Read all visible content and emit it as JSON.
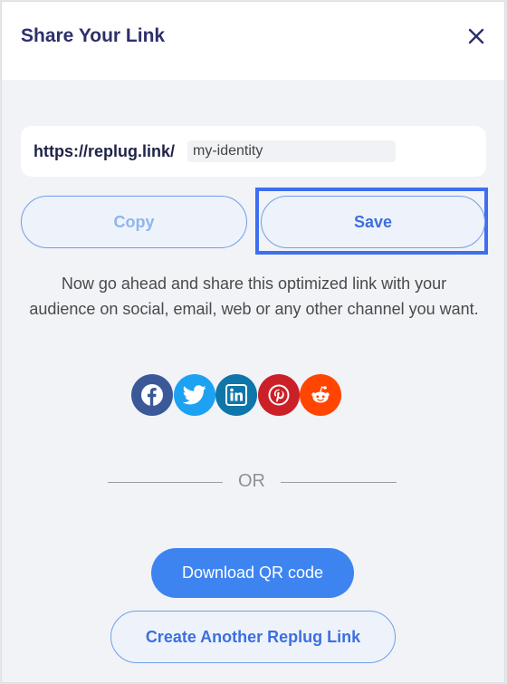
{
  "dialog": {
    "title": "Share Your Link",
    "close_icon": "close-icon"
  },
  "link": {
    "base_url": "https://replug.link/",
    "slug_value": "my-identity"
  },
  "buttons": {
    "copy_label": "Copy",
    "save_label": "Save",
    "download_qr_label": "Download QR code",
    "create_another_label": "Create Another Replug Link"
  },
  "message": "Now go ahead and share this optimized link with your audience on social, email, web or any other channel you want.",
  "socials": [
    {
      "name": "facebook-icon",
      "color": "#3b5998"
    },
    {
      "name": "twitter-icon",
      "color": "#1da1f2"
    },
    {
      "name": "linkedin-icon",
      "color": "#0e76a8"
    },
    {
      "name": "pinterest-icon",
      "color": "#cb2027"
    },
    {
      "name": "reddit-icon",
      "color": "#ff4500"
    }
  ],
  "divider_text": "OR",
  "colors": {
    "accent": "#3e84f0",
    "title": "#2d2f6b",
    "focus_outline": "#3f6ff0"
  }
}
